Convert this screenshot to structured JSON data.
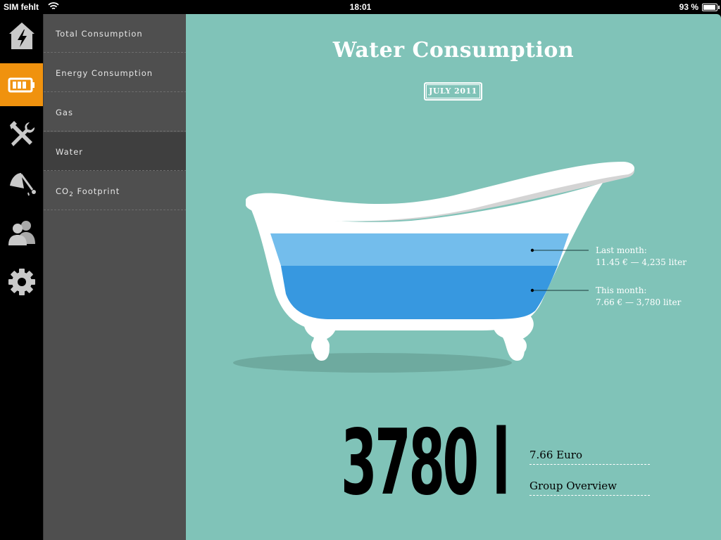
{
  "status_bar": {
    "carrier": "SIM fehlt",
    "time": "18:01",
    "battery": "93 %"
  },
  "rail": {
    "items": [
      {
        "icon": "house-lightning-icon",
        "active": false
      },
      {
        "icon": "battery-icon",
        "active": true
      },
      {
        "icon": "tools-icon",
        "active": false
      },
      {
        "icon": "shower-icon",
        "active": false
      },
      {
        "icon": "group-icon",
        "active": false
      },
      {
        "icon": "gear-icon",
        "active": false
      }
    ],
    "active_color": "#f0920e"
  },
  "submenu": {
    "items": [
      {
        "label": "Total Consumption"
      },
      {
        "label": "Energy Consumption"
      },
      {
        "label": "Gas"
      },
      {
        "label": "Water",
        "active": true
      },
      {
        "label_prefix": "CO",
        "label_sub": "2",
        "label_suffix": " Footprint"
      }
    ]
  },
  "main": {
    "title": "Water Consumption",
    "date": "JULY 2011",
    "background": "#80c3b8",
    "legend": {
      "last_month_label": "Last month:",
      "last_month_value": "11.45 € — 4,235 liter",
      "this_month_label": "This month:",
      "this_month_value": "7.66 € — 3,780 liter"
    },
    "big_value": "3780 l",
    "cost": "7.66 Euro",
    "group_link": "Group Overview"
  }
}
